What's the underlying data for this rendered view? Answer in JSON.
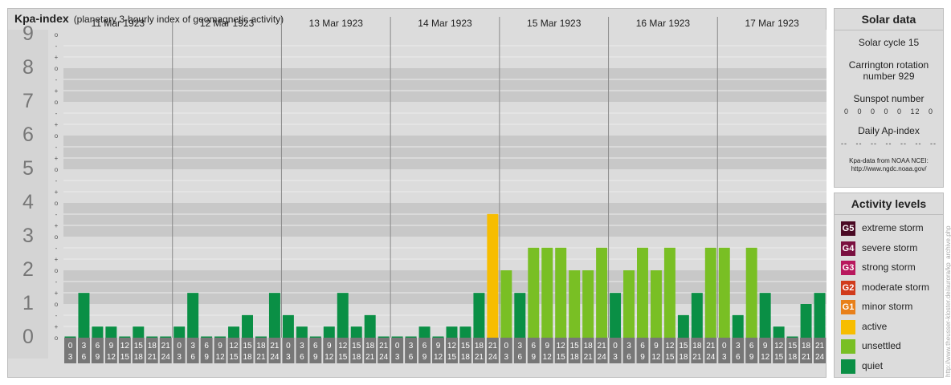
{
  "header": {
    "title": "Kpa-index",
    "subtitle": "(planetary 3-hourly index of geomagnetic activity)"
  },
  "chart_data": {
    "type": "bar",
    "title": "Kpa-index",
    "subtitle": "(planetary 3-hourly index of geomagnetic activity)",
    "ylim": [
      0,
      9
    ],
    "y_ticks": [
      "0",
      "1",
      "2",
      "3",
      "4",
      "5",
      "6",
      "7",
      "8",
      "9"
    ],
    "minor_ticks": [
      "o",
      "+",
      "-"
    ],
    "days": [
      "11 Mar 1923",
      "12 Mar 1923",
      "13 Mar 1923",
      "14 Mar 1923",
      "15 Mar 1923",
      "16 Mar 1923",
      "17 Mar 1923"
    ],
    "interval_start": [
      "0",
      "3",
      "6",
      "9",
      "12",
      "15",
      "18",
      "21"
    ],
    "interval_end": [
      "3",
      "6",
      "9",
      "12",
      "15",
      "18",
      "21",
      "24"
    ],
    "values": [
      0.0,
      1.33,
      0.33,
      0.33,
      0.0,
      0.33,
      0.0,
      0.0,
      0.33,
      1.33,
      0.0,
      0.0,
      0.33,
      0.67,
      0.0,
      1.33,
      0.67,
      0.33,
      0.0,
      0.33,
      1.33,
      0.33,
      0.67,
      0.0,
      0.0,
      0.0,
      0.33,
      0.0,
      0.33,
      0.33,
      1.33,
      3.67,
      2.0,
      1.33,
      2.67,
      2.67,
      2.67,
      2.0,
      2.0,
      2.67,
      1.33,
      2.0,
      2.67,
      2.0,
      2.67,
      0.67,
      1.33,
      2.67,
      2.67,
      0.67,
      2.67,
      1.33,
      0.33,
      0.0,
      1.0,
      1.33
    ],
    "levels": [
      "quiet",
      "quiet",
      "quiet",
      "quiet",
      "quiet",
      "quiet",
      "quiet",
      "quiet",
      "quiet",
      "quiet",
      "quiet",
      "quiet",
      "quiet",
      "quiet",
      "quiet",
      "quiet",
      "quiet",
      "quiet",
      "quiet",
      "quiet",
      "quiet",
      "quiet",
      "quiet",
      "quiet",
      "quiet",
      "quiet",
      "quiet",
      "quiet",
      "quiet",
      "quiet",
      "quiet",
      "active",
      "unsettled",
      "quiet",
      "unsettled",
      "unsettled",
      "unsettled",
      "unsettled",
      "unsettled",
      "unsettled",
      "quiet",
      "unsettled",
      "unsettled",
      "unsettled",
      "unsettled",
      "quiet",
      "quiet",
      "unsettled",
      "unsettled",
      "quiet",
      "unsettled",
      "quiet",
      "quiet",
      "quiet",
      "quiet",
      "quiet"
    ],
    "colors": {
      "quiet": "#0a8f45",
      "unsettled": "#79bf24",
      "active": "#f7bd00"
    }
  },
  "solar": {
    "title": "Solar data",
    "cycle": "Solar cycle 15",
    "carrington_1": "Carrington rotation",
    "carrington_2": "number 929",
    "sunspot_label": "Sunspot number",
    "sunspot_values": "0   0   0   0   0   12   0",
    "ap_label": "Daily Ap-index",
    "ap_values": "--   --   --   --   --   --   --",
    "source_1": "Kpa-data from NOAA NCEI:",
    "source_2": "http://www.ngdc.noaa.gov/"
  },
  "activity": {
    "title": "Activity levels",
    "items": [
      {
        "badge": "G5",
        "label": "extreme storm",
        "color": "#4a0a24"
      },
      {
        "badge": "G4",
        "label": "severe storm",
        "color": "#7a0f3f"
      },
      {
        "badge": "G3",
        "label": "strong storm",
        "color": "#b8185d"
      },
      {
        "badge": "G2",
        "label": "moderate storm",
        "color": "#d13b1c"
      },
      {
        "badge": "G1",
        "label": "minor storm",
        "color": "#e8801a"
      },
      {
        "badge": "",
        "label": "active",
        "color": "#f7bd00"
      },
      {
        "badge": "",
        "label": "unsettled",
        "color": "#79bf24"
      },
      {
        "badge": "",
        "label": "quiet",
        "color": "#0a8f45"
      }
    ]
  },
  "watermark": "http://www.theusser-kloster.de/aurora/kp_archive.php"
}
